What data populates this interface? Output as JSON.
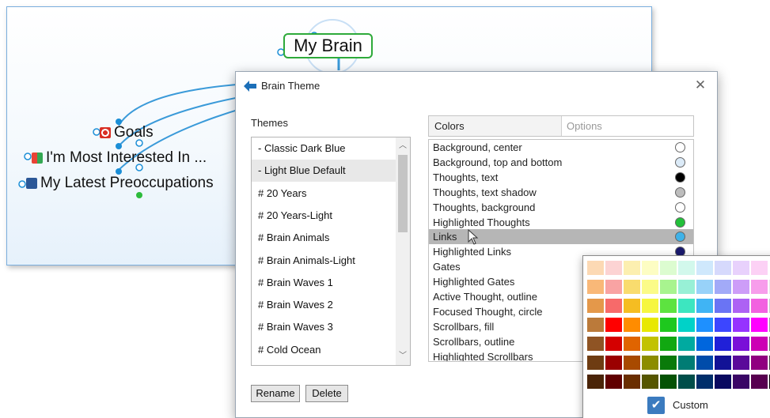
{
  "brain_map": {
    "central_thought": "My Brain",
    "child_thoughts": [
      {
        "label": "Goals",
        "icon": "target-icon"
      },
      {
        "label": "I'm Most Interested In ...",
        "icon": "tiles-icon"
      },
      {
        "label": "My Latest Preoccupations",
        "icon": "word-doc-icon"
      }
    ],
    "colors": {
      "link": "#3a9ad9",
      "active_outline": "#2eaa3a",
      "node_dot": "#1b8ed6",
      "green_gate": "#2dbb3c"
    }
  },
  "dialog": {
    "title": "Brain Theme",
    "close_glyph": "✕",
    "themes_label": "Themes",
    "themes": [
      "- Classic Dark Blue",
      "- Light Blue Default",
      "# 20 Years",
      "# 20 Years-Light",
      "# Brain Animals",
      "# Brain Animals-Light",
      "# Brain Waves 1",
      "# Brain Waves 2",
      "# Brain Waves 3",
      "# Cold Ocean"
    ],
    "selected_theme_index": 1,
    "buttons": {
      "rename": "Rename",
      "delete": "Delete"
    },
    "tabs": {
      "colors": "Colors",
      "options": "Options"
    },
    "color_items": [
      {
        "label": "Background, center",
        "swatch": "#ffffff"
      },
      {
        "label": "Background, top and bottom",
        "swatch": "#dcebf8"
      },
      {
        "label": "Thoughts, text",
        "swatch": "#000000"
      },
      {
        "label": "Thoughts, text shadow",
        "swatch": "#bdbdbd"
      },
      {
        "label": "Thoughts, background",
        "swatch": "#ffffff"
      },
      {
        "label": "Highlighted Thoughts",
        "swatch": "#22c03a"
      },
      {
        "label": "Links",
        "swatch": "#3fb2e8"
      },
      {
        "label": "Highlighted Links",
        "swatch": "#1a1a6e"
      },
      {
        "label": "Gates",
        "swatch": ""
      },
      {
        "label": "Highlighted Gates",
        "swatch": ""
      },
      {
        "label": "Active Thought, outline",
        "swatch": ""
      },
      {
        "label": "Focused Thought, circle",
        "swatch": ""
      },
      {
        "label": "Scrollbars, fill",
        "swatch": ""
      },
      {
        "label": "Scrollbars, outline",
        "swatch": ""
      },
      {
        "label": "Highlighted Scrollbars",
        "swatch": ""
      }
    ],
    "selected_color_index": 6
  },
  "color_picker": {
    "custom_label": "Custom",
    "custom_checked": true,
    "palette_rows": [
      [
        "#fcd9b4",
        "#fcd3d3",
        "#fcefb0",
        "#fdfdc3",
        "#dcfcd0",
        "#d2f8ec",
        "#cfe8fc",
        "#d6d9fc",
        "#e8d1fc",
        "#fcd1f5",
        "#ffffff"
      ],
      [
        "#f9b878",
        "#f9a3a3",
        "#f9dc6e",
        "#fbfb88",
        "#a8f48f",
        "#98f0d6",
        "#98d2f9",
        "#a2aaf8",
        "#cd9df8",
        "#f79deb",
        "#e6e6e6"
      ],
      [
        "#e4984a",
        "#f76a6a",
        "#f5bd22",
        "#f6f640",
        "#5de340",
        "#3de6c0",
        "#40b4f4",
        "#6a74f4",
        "#ad62f4",
        "#f262e0",
        "#c8c8c8"
      ],
      [
        "#bb7a3a",
        "#ff0000",
        "#ff8c00",
        "#e8e800",
        "#1ec81e",
        "#00d2c8",
        "#1e90ff",
        "#3c46ff",
        "#9632ff",
        "#ff00ff",
        "#9a9a9a"
      ],
      [
        "#8f5424",
        "#d40000",
        "#e06400",
        "#c2c200",
        "#11a811",
        "#00aaa0",
        "#0066dd",
        "#2020d8",
        "#7a10d8",
        "#cc00b4",
        "#6e6e6e"
      ],
      [
        "#6e3c12",
        "#9a0000",
        "#a84a00",
        "#8c8c00",
        "#0a7a0a",
        "#007c74",
        "#004caa",
        "#121296",
        "#5a0a9a",
        "#900080",
        "#444444"
      ],
      [
        "#4a2408",
        "#600000",
        "#6a2e00",
        "#565600",
        "#045204",
        "#004e4a",
        "#002e6a",
        "#0a0a60",
        "#3a0666",
        "#580050",
        "#000000"
      ]
    ]
  }
}
